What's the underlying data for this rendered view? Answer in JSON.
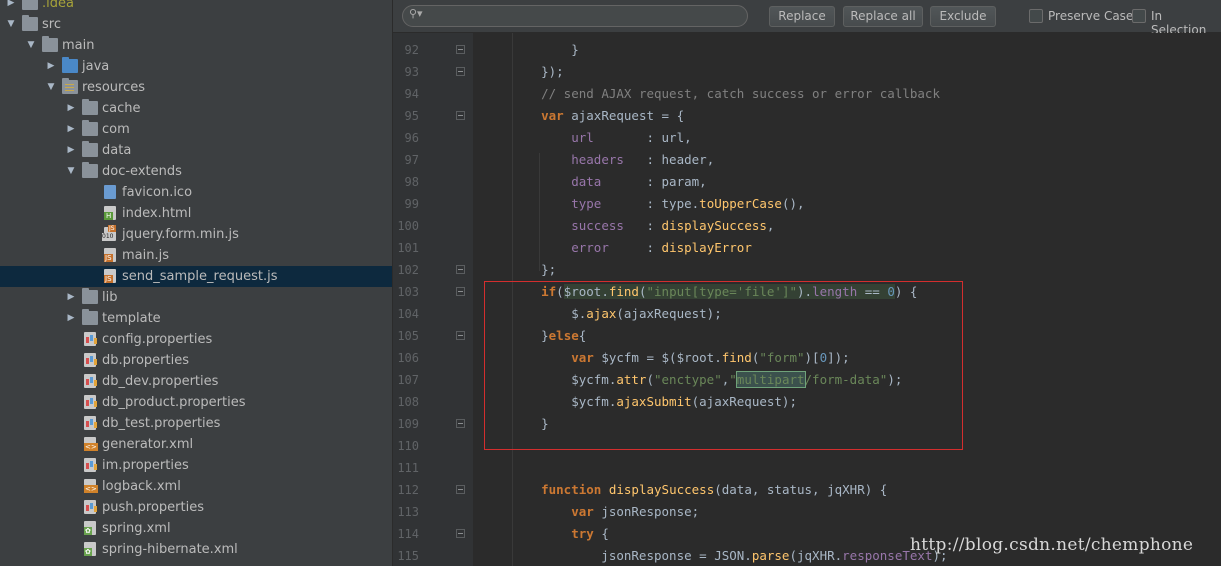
{
  "tree": {
    "items": [
      {
        "label": ".idea",
        "indent": 0,
        "icon": "folder",
        "expanded": false,
        "selected": false
      },
      {
        "label": "src",
        "indent": 0,
        "icon": "folder",
        "expanded": true,
        "selected": false
      },
      {
        "label": "main",
        "indent": 1,
        "icon": "folder",
        "expanded": true,
        "selected": false
      },
      {
        "label": "java",
        "indent": 2,
        "icon": "folder-blue",
        "expanded": false,
        "selected": false
      },
      {
        "label": "resources",
        "indent": 2,
        "icon": "folder-res",
        "expanded": true,
        "selected": false
      },
      {
        "label": "cache",
        "indent": 3,
        "icon": "folder",
        "expanded": false,
        "selected": false
      },
      {
        "label": "com",
        "indent": 3,
        "icon": "folder",
        "expanded": false,
        "selected": false
      },
      {
        "label": "data",
        "indent": 3,
        "icon": "folder",
        "expanded": false,
        "selected": false
      },
      {
        "label": "doc-extends",
        "indent": 3,
        "icon": "folder",
        "expanded": true,
        "selected": false
      },
      {
        "label": "favicon.ico",
        "indent": 4,
        "icon": "file-ico",
        "expanded": null,
        "selected": false
      },
      {
        "label": "index.html",
        "indent": 4,
        "icon": "file-html",
        "expanded": null,
        "selected": false
      },
      {
        "label": "jquery.form.min.js",
        "indent": 4,
        "icon": "file-bin",
        "expanded": null,
        "selected": false
      },
      {
        "label": "main.js",
        "indent": 4,
        "icon": "file-js",
        "expanded": null,
        "selected": false
      },
      {
        "label": "send_sample_request.js",
        "indent": 4,
        "icon": "file-js",
        "expanded": null,
        "selected": true
      },
      {
        "label": "lib",
        "indent": 3,
        "icon": "folder",
        "expanded": false,
        "selected": false
      },
      {
        "label": "template",
        "indent": 3,
        "icon": "folder",
        "expanded": false,
        "selected": false
      },
      {
        "label": "config.properties",
        "indent": 3,
        "icon": "file-prop",
        "expanded": null,
        "selected": false
      },
      {
        "label": "db.properties",
        "indent": 3,
        "icon": "file-prop",
        "expanded": null,
        "selected": false
      },
      {
        "label": "db_dev.properties",
        "indent": 3,
        "icon": "file-prop",
        "expanded": null,
        "selected": false
      },
      {
        "label": "db_product.properties",
        "indent": 3,
        "icon": "file-prop",
        "expanded": null,
        "selected": false
      },
      {
        "label": "db_test.properties",
        "indent": 3,
        "icon": "file-prop",
        "expanded": null,
        "selected": false
      },
      {
        "label": "generator.xml",
        "indent": 3,
        "icon": "file-xml",
        "expanded": null,
        "selected": false
      },
      {
        "label": "im.properties",
        "indent": 3,
        "icon": "file-prop",
        "expanded": null,
        "selected": false
      },
      {
        "label": "logback.xml",
        "indent": 3,
        "icon": "file-xml",
        "expanded": null,
        "selected": false
      },
      {
        "label": "push.properties",
        "indent": 3,
        "icon": "file-prop",
        "expanded": null,
        "selected": false
      },
      {
        "label": "spring.xml",
        "indent": 3,
        "icon": "file-spring",
        "expanded": null,
        "selected": false
      },
      {
        "label": "spring-hibernate.xml",
        "indent": 3,
        "icon": "file-spring",
        "expanded": null,
        "selected": false
      }
    ]
  },
  "findbar": {
    "search_value": "",
    "replace_label": "Replace",
    "replace_all_label": "Replace all",
    "exclude_label": "Exclude",
    "preserve_case_label": "Preserve Case",
    "in_selection_label": "In Selection"
  },
  "editor": {
    "lines": [
      {
        "num": "92",
        "fold": true,
        "html": "        }"
      },
      {
        "num": "93",
        "fold": true,
        "html": "    });"
      },
      {
        "num": "94",
        "fold": false,
        "html": "    <span class=\"cmt\">// send AJAX request, catch success or error callback</span>"
      },
      {
        "num": "95",
        "fold": true,
        "html": "    <span class=\"kw\">var</span> ajaxRequest = {"
      },
      {
        "num": "96",
        "fold": false,
        "html": "        <span class=\"prop\">url</span>       : url,"
      },
      {
        "num": "97",
        "fold": false,
        "html": "        <span class=\"prop\">headers</span>   : header,"
      },
      {
        "num": "98",
        "fold": false,
        "html": "        <span class=\"prop\">data</span>      : param,"
      },
      {
        "num": "99",
        "fold": false,
        "html": "        <span class=\"prop\">type</span>      : type.<span class=\"fn\">toUpperCase</span>(),"
      },
      {
        "num": "100",
        "fold": false,
        "html": "        <span class=\"prop\">success</span>   : <span class=\"fn\">displaySuccess</span>,"
      },
      {
        "num": "101",
        "fold": false,
        "html": "        <span class=\"prop\">error</span>     : <span class=\"fn\">displayError</span>"
      },
      {
        "num": "102",
        "fold": true,
        "html": "    };"
      },
      {
        "num": "103",
        "fold": true,
        "html": "    <span class=\"kw\">if</span>(<span class=\"hl-green\">$root.<span class=\"fn\">find</span>(<span class=\"str\">\"input[type='file']\"</span>).<span class=\"prop\">length</span> == <span class=\"num\">0</span></span>) {"
      },
      {
        "num": "104",
        "fold": false,
        "html": "        $.<span class=\"fn\">ajax</span>(ajaxRequest);"
      },
      {
        "num": "105",
        "fold": true,
        "html": "    }<span class=\"kw\">else</span>{"
      },
      {
        "num": "106",
        "fold": false,
        "html": "        <span class=\"kw\">var</span> $ycfm = $($root.<span class=\"fn\">find</span>(<span class=\"str\">\"form\"</span>)[<span class=\"num\">0</span>]);"
      },
      {
        "num": "107",
        "fold": false,
        "html": "        $ycfm.<span class=\"fn\">attr</span>(<span class=\"str\">\"enctype\"</span>,<span class=\"str\">\"<span class=\"hl-box\">multipart</span>/form-data\"</span>);"
      },
      {
        "num": "108",
        "fold": false,
        "html": "        $ycfm.<span class=\"fn\">ajaxSubmit</span>(ajaxRequest);"
      },
      {
        "num": "109",
        "fold": true,
        "html": "    }"
      },
      {
        "num": "110",
        "fold": false,
        "html": ""
      },
      {
        "num": "111",
        "fold": false,
        "html": ""
      },
      {
        "num": "112",
        "fold": true,
        "html": "    <span class=\"kw\">function</span> <span class=\"fn\">displaySuccess</span>(data, status, jqXHR) {"
      },
      {
        "num": "113",
        "fold": false,
        "html": "        <span class=\"kw\">var</span> jsonResponse;"
      },
      {
        "num": "114",
        "fold": true,
        "html": "        <span class=\"kw\">try</span> {"
      },
      {
        "num": "115",
        "fold": false,
        "html": "            jsonResponse = JSON.<span class=\"fn\">parse</span>(jqXHR.<span class=\"prop\">responseText</span>);"
      }
    ]
  },
  "watermark": "http://blog.csdn.net/chemphone"
}
